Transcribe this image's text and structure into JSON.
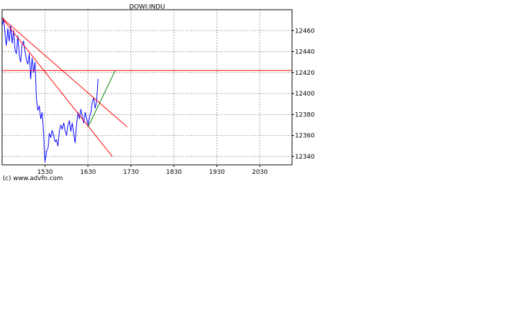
{
  "credit": "(c) www.advfn.com",
  "colors": {
    "price_line": "#0000ff",
    "trend_lines": "#ff0000",
    "projection_line": "#008000",
    "grid": "#a0a0a0",
    "frame": "#000000"
  },
  "chart_data": {
    "type": "line",
    "title": "DOWI:INDU",
    "xlabel": "",
    "ylabel": "",
    "x_ticks": [
      "1530",
      "1630",
      "1730",
      "1830",
      "1930",
      "2030"
    ],
    "y_ticks": [
      12340,
      12360,
      12380,
      12400,
      12420,
      12440,
      12460
    ],
    "xlim": [
      "14:30",
      "21:15"
    ],
    "ylim": [
      12332,
      12480
    ],
    "grid": true,
    "y_axis_side": "right",
    "series": [
      {
        "style": "price",
        "points": [
          [
            "14:30",
            12464
          ],
          [
            "14:32",
            12472
          ],
          [
            "14:34",
            12458
          ],
          [
            "14:36",
            12446
          ],
          [
            "14:38",
            12462
          ],
          [
            "14:40",
            12450
          ],
          [
            "14:42",
            12465
          ],
          [
            "14:44",
            12448
          ],
          [
            "14:46",
            12460
          ],
          [
            "14:48",
            12442
          ],
          [
            "14:50",
            12438
          ],
          [
            "14:52",
            12455
          ],
          [
            "14:54",
            12436
          ],
          [
            "14:56",
            12430
          ],
          [
            "14:58",
            12447
          ],
          [
            "15:00",
            12450
          ],
          [
            "15:02",
            12440
          ],
          [
            "15:04",
            12432
          ],
          [
            "15:06",
            12428
          ],
          [
            "15:08",
            12438
          ],
          [
            "15:10",
            12414
          ],
          [
            "15:12",
            12434
          ],
          [
            "15:14",
            12420
          ],
          [
            "15:16",
            12430
          ],
          [
            "15:18",
            12395
          ],
          [
            "15:20",
            12384
          ],
          [
            "15:22",
            12388
          ],
          [
            "15:24",
            12376
          ],
          [
            "15:26",
            12382
          ],
          [
            "15:28",
            12360
          ],
          [
            "15:30",
            12335
          ],
          [
            "15:32",
            12345
          ],
          [
            "15:34",
            12348
          ],
          [
            "15:36",
            12362
          ],
          [
            "15:38",
            12358
          ],
          [
            "15:40",
            12365
          ],
          [
            "15:42",
            12360
          ],
          [
            "15:44",
            12354
          ],
          [
            "15:46",
            12356
          ],
          [
            "15:48",
            12350
          ],
          [
            "15:50",
            12364
          ],
          [
            "15:52",
            12370
          ],
          [
            "15:54",
            12366
          ],
          [
            "15:56",
            12372
          ],
          [
            "15:58",
            12365
          ],
          [
            "16:00",
            12360
          ],
          [
            "16:02",
            12370
          ],
          [
            "16:04",
            12374
          ],
          [
            "16:06",
            12364
          ],
          [
            "16:08",
            12372
          ],
          [
            "16:10",
            12362
          ],
          [
            "16:12",
            12353
          ],
          [
            "16:14",
            12370
          ],
          [
            "16:16",
            12382
          ],
          [
            "16:18",
            12376
          ],
          [
            "16:20",
            12385
          ],
          [
            "16:22",
            12378
          ],
          [
            "16:24",
            12372
          ],
          [
            "16:26",
            12382
          ],
          [
            "16:28",
            12376
          ],
          [
            "16:30",
            12370
          ],
          [
            "16:32",
            12377
          ],
          [
            "16:34",
            12382
          ],
          [
            "16:36",
            12392
          ],
          [
            "16:38",
            12396
          ],
          [
            "16:40",
            12386
          ],
          [
            "16:42",
            12392
          ],
          [
            "16:44",
            12414
          ]
        ]
      },
      {
        "style": "trend",
        "points": [
          [
            "14:30",
            12472
          ],
          [
            "17:25",
            12368
          ]
        ]
      },
      {
        "style": "trend",
        "points": [
          [
            "14:30",
            12472
          ],
          [
            "17:04",
            12340
          ]
        ]
      },
      {
        "style": "trend",
        "points": [
          [
            "14:30",
            12422
          ],
          [
            "21:15",
            12422
          ]
        ]
      },
      {
        "style": "projection",
        "points": [
          [
            "16:30",
            12368
          ],
          [
            "17:08",
            12422
          ]
        ]
      }
    ]
  }
}
